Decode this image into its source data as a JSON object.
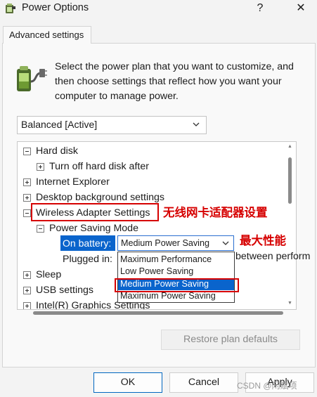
{
  "window": {
    "title": "Power Options",
    "help_label": "?",
    "close_label": "✕"
  },
  "tab": {
    "label": "Advanced settings"
  },
  "intro": {
    "text": "Select the power plan that you want to customize, and then choose settings that reflect how you want your computer to manage power."
  },
  "plan_select": {
    "value": "Balanced [Active]"
  },
  "tree": {
    "hard_disk": "Hard disk",
    "turn_off_hard_disk": "Turn off hard disk after",
    "internet_explorer": "Internet Explorer",
    "desktop_background": "Desktop background settings",
    "wireless_adapter": "Wireless Adapter Settings",
    "power_saving_mode": "Power Saving Mode",
    "on_battery_label": "On battery:",
    "on_battery_value": "Medium Power Saving",
    "plugged_in_label": "Plugged in:",
    "plugged_in_partial": "between perform",
    "sleep": "Sleep",
    "usb": "USB settings",
    "intel_graphics": "Intel(R) Graphics Settings"
  },
  "dropdown": {
    "options": [
      "Maximum Performance",
      "Low Power Saving",
      "Medium Power Saving",
      "Maximum Power Saving"
    ],
    "selected_index": 2
  },
  "annotations": {
    "wireless_note": "无线网卡适配器设置",
    "perf_note": "最大性能",
    "color": "#d60000"
  },
  "buttons": {
    "restore": "Restore plan defaults",
    "ok": "OK",
    "cancel": "Cancel",
    "apply": "Apply"
  },
  "watermark": "CSDN @闲赋项",
  "colors": {
    "selection": "#0a64cc",
    "accent_border": "#0067c0",
    "annotation_red": "#d60000"
  }
}
